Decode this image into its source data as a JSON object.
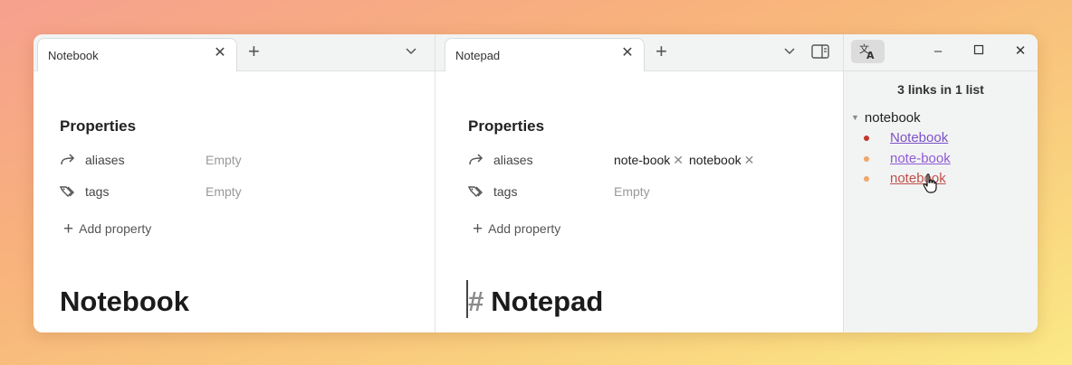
{
  "left_pane": {
    "tab_label": "Notebook",
    "properties_heading": "Properties",
    "properties": [
      {
        "name": "aliases",
        "value": "Empty"
      },
      {
        "name": "tags",
        "value": "Empty"
      }
    ],
    "add_property_label": "Add property",
    "note_title": "Notebook"
  },
  "right_pane": {
    "tab_label": "Notepad",
    "properties_heading": "Properties",
    "aliases_name": "aliases",
    "aliases_chips": [
      "note-book",
      "notebook"
    ],
    "tags_name": "tags",
    "tags_value": "Empty",
    "add_property_label": "Add property",
    "heading_marker": "#",
    "note_title": "Notepad"
  },
  "side_pane": {
    "links_count": "3 links in 1 list",
    "group_label": "notebook",
    "links": [
      {
        "text": "Notebook",
        "color": "#7c52c8",
        "dot_color": "#c0392b"
      },
      {
        "text": "note-book",
        "color": "#8f5bd6",
        "dot_color": "#f0a56a"
      },
      {
        "text": "notebook",
        "color": "#c0504a",
        "dot_color": "#f0a56a"
      }
    ]
  },
  "icons": {
    "close": "close-icon",
    "add": "plus-icon",
    "chevron": "chevron-down-icon",
    "sidebar": "sidebar-toggle-icon",
    "translate": "translate-icon",
    "minimize": "minimize-icon",
    "maximize": "maximize-icon",
    "window_close": "window-close-icon",
    "alias": "alias-arrow-icon",
    "tags": "tags-icon"
  }
}
